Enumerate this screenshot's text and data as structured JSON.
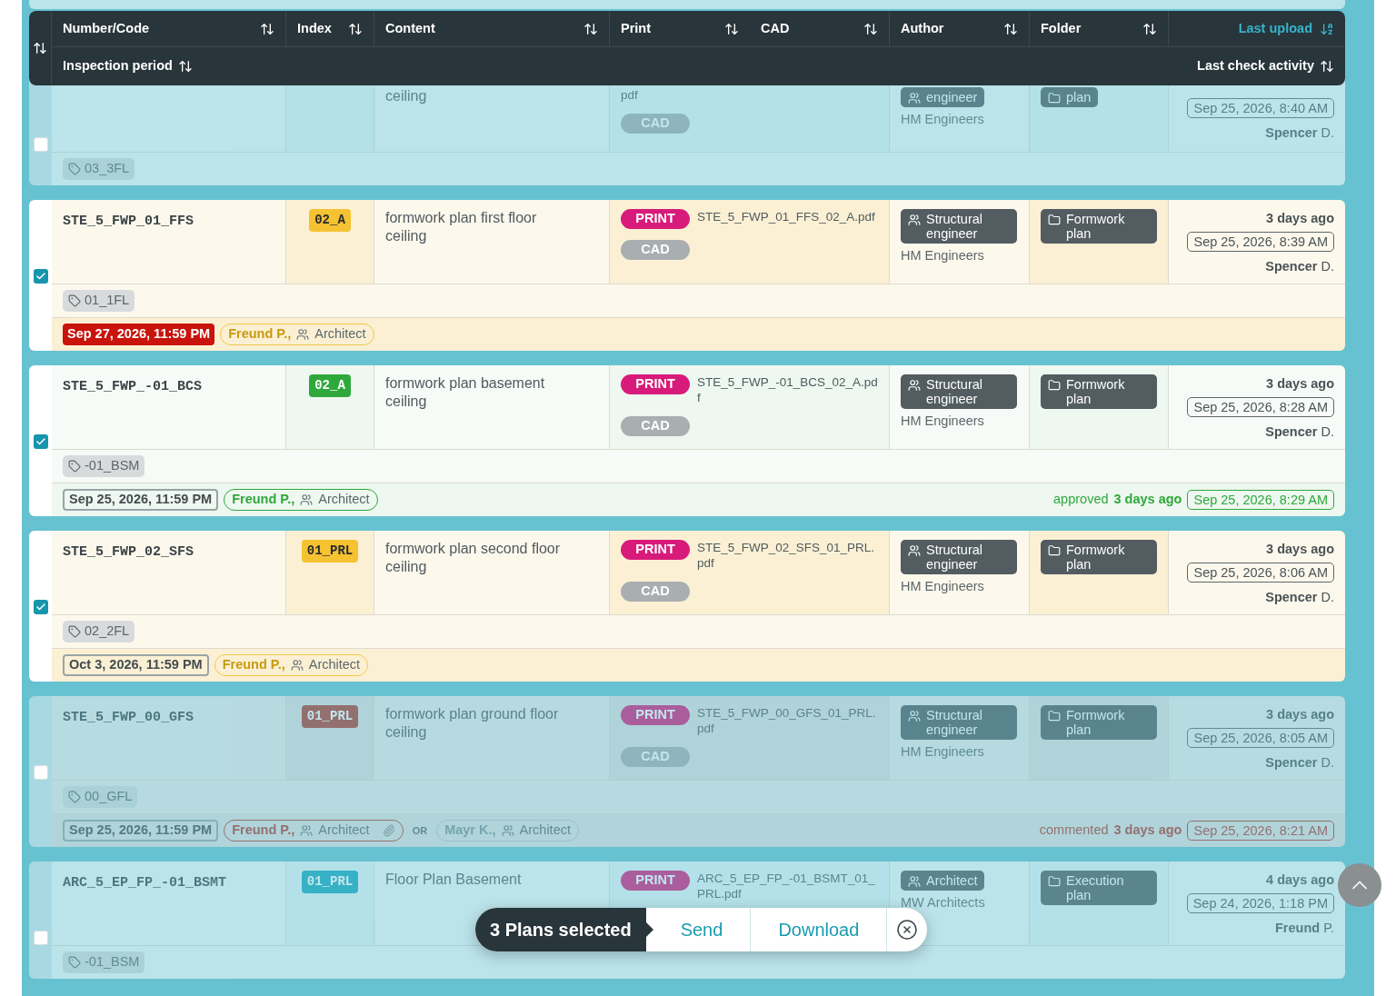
{
  "header": {
    "columns": [
      {
        "label": "Number/Code",
        "active": false
      },
      {
        "label": "Index",
        "active": false
      },
      {
        "label": "Content",
        "active": false
      },
      {
        "label": "Print",
        "active": false
      },
      {
        "label": "CAD",
        "active": false
      },
      {
        "label": "Author",
        "active": false
      },
      {
        "label": "Folder",
        "active": false
      },
      {
        "label": "Last upload",
        "active": true
      }
    ],
    "second_row": [
      {
        "label": "Inspection period",
        "active": false
      },
      {
        "label": "Last check activity",
        "active": false
      }
    ]
  },
  "plans": [
    {
      "selected": false,
      "kind": "none",
      "content": "ceiling",
      "file": "pdf",
      "cad": "CAD",
      "author": {
        "role": "engineer",
        "company": "HM Engineers"
      },
      "folder": "plan",
      "uploaded": {
        "date": "Sep 25, 2026, 8:40 AM",
        "by": "**Spencer** D."
      },
      "tag": "03_3FL"
    },
    {
      "selected": true,
      "kind": "pending",
      "code": "STE_5_FWP_01_FFS",
      "index": {
        "label": "02_A",
        "kind": "pending"
      },
      "content": "formwork plan first floor ceiling",
      "print": "PRINT",
      "file": "STE_5_FWP_01_FFS_02_A.pdf",
      "cad": "CAD",
      "author": {
        "role": "Structural engineer",
        "company": "HM Engineers"
      },
      "folder": "Formwork plan",
      "uploaded": {
        "ago": "3 days ago",
        "date": "Sep 25, 2026, 8:39 AM",
        "by": "**Spencer** D."
      },
      "tag": "01_1FL",
      "inspection": {
        "deadline": "Sep 27, 2026, 11:59 PM",
        "overdue": true,
        "reviewers": [
          {
            "name": "Freund P.,",
            "role": "Architect",
            "kind": "pending",
            "attachment": false
          }
        ]
      }
    },
    {
      "selected": true,
      "kind": "approved",
      "code": "STE_5_FWP_-01_BCS",
      "index": {
        "label": "02_A",
        "kind": "approved"
      },
      "content": "formwork plan basement ceiling",
      "print": "PRINT",
      "file": "STE_5_FWP_-01_BCS_02_A.pdf",
      "cad": "CAD",
      "author": {
        "role": "Structural engineer",
        "company": "HM Engineers"
      },
      "folder": "Formwork plan",
      "uploaded": {
        "ago": "3 days ago",
        "date": "Sep 25, 2026, 8:28 AM",
        "by": "**Spencer** D."
      },
      "tag": "-01_BSM",
      "inspection": {
        "deadline": "Sep 25, 2026, 11:59 PM",
        "overdue": false,
        "reviewers": [
          {
            "name": "Freund P.,",
            "role": "Architect",
            "kind": "approved",
            "attachment": false
          }
        ],
        "activity": {
          "verb": "approved",
          "ago": "3 days ago",
          "date": "Sep 25, 2026, 8:29 AM",
          "kind": "approved"
        }
      }
    },
    {
      "selected": true,
      "kind": "pending",
      "code": "STE_5_FWP_02_SFS",
      "index": {
        "label": "01_PRL",
        "kind": "pending"
      },
      "content": "formwork plan second floor ceiling",
      "print": "PRINT",
      "file": "STE_5_FWP_02_SFS_01_PRL.pdf",
      "cad": "CAD",
      "author": {
        "role": "Structural engineer",
        "company": "HM Engineers"
      },
      "folder": "Formwork plan",
      "uploaded": {
        "ago": "3 days ago",
        "date": "Sep 25, 2026, 8:06 AM",
        "by": "**Spencer** D."
      },
      "tag": "02_2FL",
      "inspection": {
        "deadline": "Oct 3, 2026, 11:59 PM",
        "overdue": false,
        "reviewers": [
          {
            "name": "Freund P.,",
            "role": "Architect",
            "kind": "pending",
            "attachment": false
          }
        ]
      }
    },
    {
      "selected": false,
      "kind": "commented",
      "code": "STE_5_FWP_00_GFS",
      "index": {
        "label": "01_PRL",
        "kind": "commented"
      },
      "content": "formwork plan ground floor ceiling",
      "print": "PRINT",
      "file": "STE_5_FWP_00_GFS_01_PRL.pdf",
      "cad": "CAD",
      "author": {
        "role": "Structural engineer",
        "company": "HM Engineers"
      },
      "folder": "Formwork plan",
      "uploaded": {
        "ago": "3 days ago",
        "date": "Sep 25, 2026, 8:05 AM",
        "by": "**Spencer** D."
      },
      "tag": "00_GFL",
      "inspection": {
        "deadline": "Sep 25, 2026, 11:59 PM",
        "overdue": false,
        "joiner": "OR",
        "reviewers": [
          {
            "name": "Freund P.,",
            "role": "Architect",
            "kind": "commented",
            "attachment": true
          },
          {
            "name": "Mayr K.,",
            "role": "Architect",
            "kind": "inactive",
            "attachment": false
          }
        ],
        "activity": {
          "verb": "commented",
          "ago": "3 days ago",
          "date": "Sep 25, 2026, 8:21 AM",
          "kind": "commented"
        }
      }
    },
    {
      "selected": false,
      "kind": "none",
      "code": "ARC_5_EP_FP_-01_BSMT",
      "index": {
        "label": "01_PRL",
        "kind": "draft"
      },
      "content": "Floor Plan Basement",
      "print": "PRINT",
      "file": "ARC_5_EP_FP_-01_BSMT_01_PRL.pdf",
      "author": {
        "role": "Architect",
        "company": "MW Architects"
      },
      "folder": "Execution plan",
      "uploaded": {
        "ago": "4 days ago",
        "date": "Sep 24, 2026, 1:18 PM",
        "by": "**Freund** P."
      },
      "tag": "-01_BSM"
    }
  ],
  "selection": {
    "count": "3 Plans selected",
    "actions": [
      "Send",
      "Download"
    ]
  }
}
